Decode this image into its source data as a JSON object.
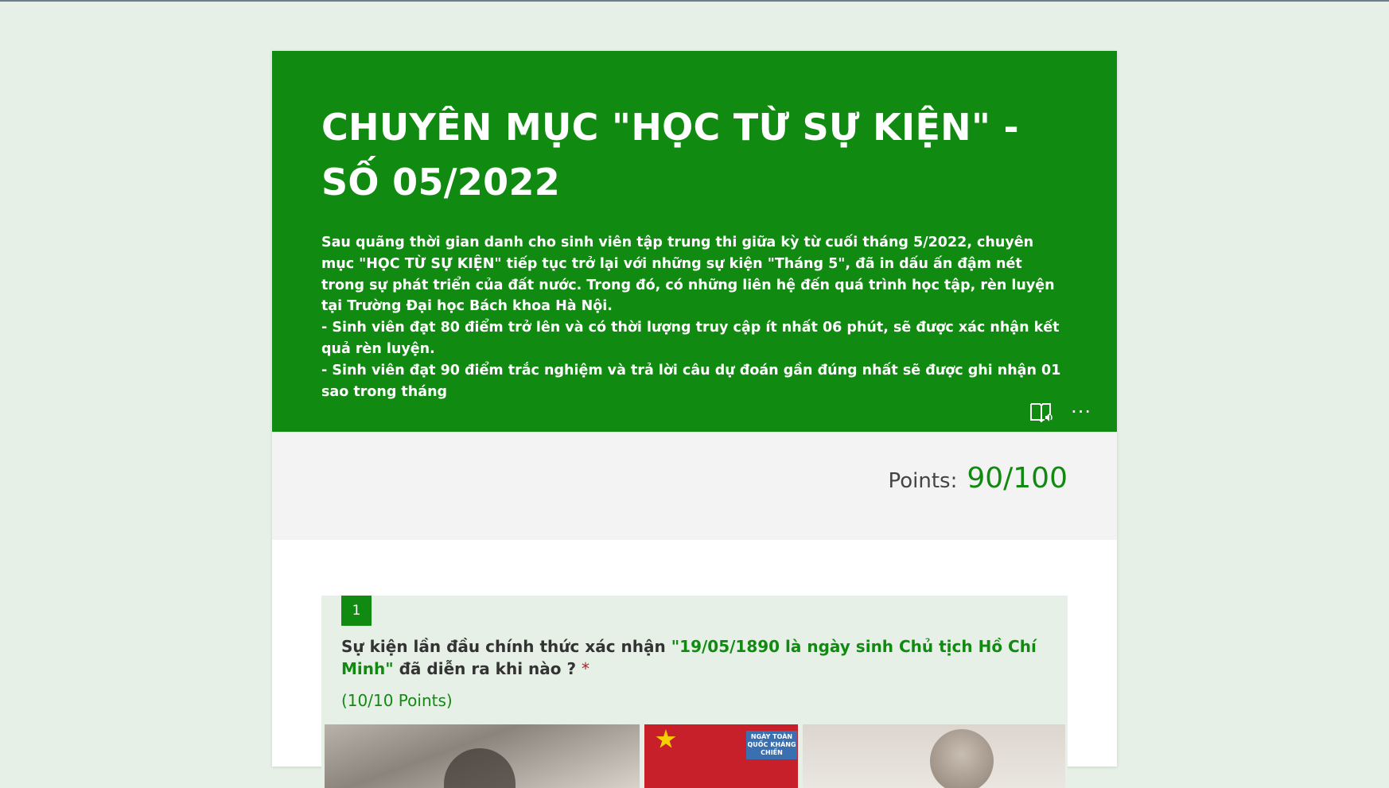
{
  "form": {
    "title": "CHUYÊN MỤC \"HỌC TỪ SỰ KIỆN\" - SỐ 05/2022",
    "description": [
      "Sau quãng thời gian danh cho sinh viên tập trung thi giữa kỳ từ cuối tháng 5/2022, chuyên mục \"HỌC TỪ SỰ KIỆN\" tiếp tục trở lại với những sự kiện \"Tháng 5\", đã in dấu ấn đậm nét trong sự phát triển của đất nước. Trong đó, có những liên hệ đến quá trình học tập, rèn luyện tại Trường Đại học Bách khoa Hà Nội.",
      "- Sinh viên đạt 80 điểm trở lên và có thời lượng truy cập ít nhất 06 phút, sẽ được xác nhận kết quả rèn luyện.",
      "- Sinh viên đạt 90 điểm trắc nghiệm và trả lời câu dự đoán gần đúng nhất sẽ được ghi nhận 01 sao trong tháng"
    ],
    "header_icons": {
      "reader": "immersive-reader-icon",
      "more": "more-options-icon",
      "more_glyph": "···"
    }
  },
  "score": {
    "label": "Points:",
    "value": "90/100"
  },
  "question": {
    "number": "1",
    "text_before": "Sự kiện lần đầu chính thức xác nhận ",
    "highlight": "\"19/05/1890 là ngày sinh Chủ tịch Hồ Chí Minh\"",
    "text_after": " đã diễn ra khi nào ?",
    "required_mark": "*",
    "points": "(10/10 Points)",
    "poster_caption": "NGÀY TOÀN QUỐC KHÁNG CHIẾN"
  },
  "colors": {
    "theme": "#108a10",
    "page_background": "#e6f0e6",
    "points_bar": "#f3f3f3",
    "required": "#a4262c"
  }
}
